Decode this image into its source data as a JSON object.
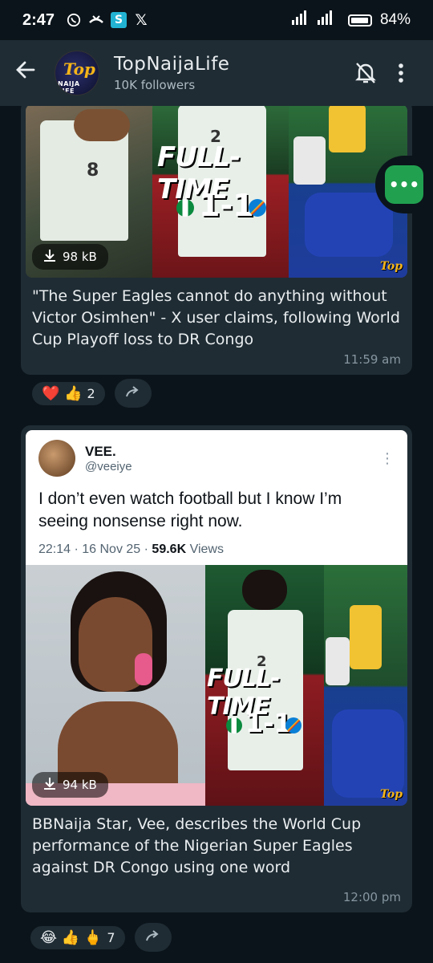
{
  "status": {
    "time": "2:47",
    "battery": "84%",
    "icons": [
      "whatsapp-icon",
      "missed-call-icon",
      "s-app-icon",
      "x-icon"
    ]
  },
  "header": {
    "channel_name": "TopNaijaLife",
    "followers": "10K followers",
    "avatar_logo": "Top",
    "avatar_sub": "NAIJA LIFE"
  },
  "messages": [
    {
      "overlay_text": "FULL-TIME",
      "score": "1-1",
      "jersey_number": "2",
      "download_size": "98 kB",
      "caption": "\"The Super Eagles cannot do anything without Victor Osimhen\" - X user claims, following World Cup Playoff loss to DR Congo",
      "time": "11:59 am",
      "reactions": {
        "emojis": "❤️ 👍",
        "count": "2"
      },
      "watermark": "Top"
    },
    {
      "tweet": {
        "user": "VEE.",
        "handle": "@veeiye",
        "text": "I don’t even watch football but I know I’m seeing nonsense right now.",
        "meta_time": "22:14 · 16 Nov 25 · ",
        "views_num": "59.6K",
        "views_label": " Views"
      },
      "overlay_text": "FULL-TIME",
      "score": "1-1",
      "jersey_number": "2",
      "download_size": "94 kB",
      "caption": "BBNaija Star, Vee, describes the World Cup performance of the Nigerian Super Eagles against DR Congo using one word",
      "time": "12:00 pm",
      "reactions": {
        "emojis": "😂 👍 🖕",
        "count": "7"
      },
      "watermark": "Top"
    }
  ],
  "colors": {
    "header_bg": "#1f2c34",
    "chat_bg": "#0b141a",
    "bubble_bg": "#1f2c34",
    "accent_green": "#21a150"
  }
}
